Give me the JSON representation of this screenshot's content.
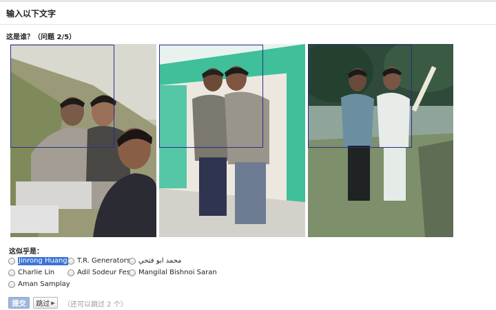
{
  "header": {
    "title": "输入以下文字"
  },
  "question": {
    "text": "这是谁？（问题 2/5）"
  },
  "photos": [
    {
      "icon": "selfie-photo"
    },
    {
      "icon": "two-men-photo"
    },
    {
      "icon": "cricket-field-photo"
    }
  ],
  "options": {
    "label": "这似乎是：",
    "items": [
      {
        "label": "Jinrong Huang",
        "selected_highlight": true
      },
      {
        "label": "T.R. Generators"
      },
      {
        "label": "محمد ابو فتحي"
      },
      {
        "label": "Charlie Lin"
      },
      {
        "label": "Adil Sodeur Fes"
      },
      {
        "label": "Mangilal Bishnoi Saran"
      },
      {
        "label": "Aman Samplay"
      }
    ]
  },
  "actions": {
    "submit_label": "提交",
    "skip_label": "跳过",
    "skip_note": "（还可以跳过 2 个）"
  },
  "colors": {
    "face_box": "#2b2d8c",
    "highlight": "#3b73d6",
    "submit_bg": "#9fb8dc"
  }
}
